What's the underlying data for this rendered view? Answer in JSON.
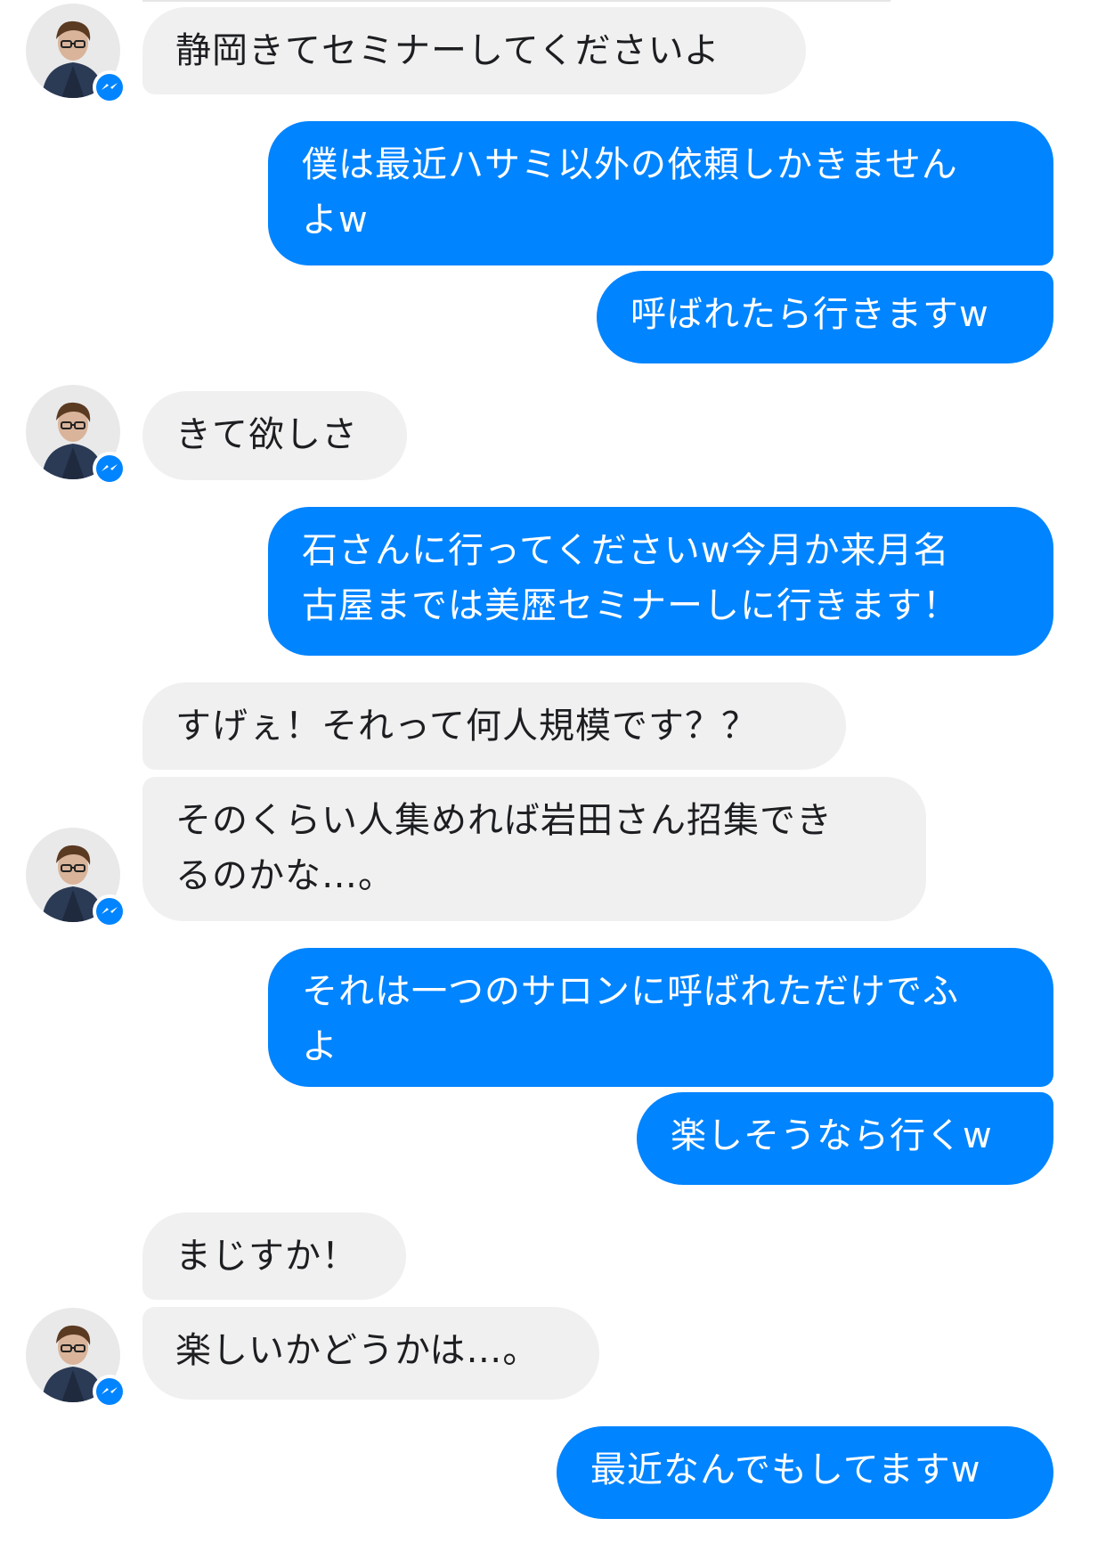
{
  "conversation": {
    "messages": [
      {
        "from": "them",
        "text": "静岡きてセミナーしてくださいよ"
      },
      {
        "from": "me",
        "text": "僕は最近ハサミ以外の依頼しかきません\nよw"
      },
      {
        "from": "me",
        "text": "呼ばれたら行きますw"
      },
      {
        "from": "them",
        "text": "きて欲しさ"
      },
      {
        "from": "me",
        "text": "石さんに行ってくださいw今月か来月名\n古屋までは美歴セミナーしに行きます！"
      },
      {
        "from": "them",
        "text": "すげぇ！それって何人規模です？？"
      },
      {
        "from": "them",
        "text": "そのくらい人集めれば岩田さん招集でき\nるのかな…。"
      },
      {
        "from": "me",
        "text": "それは一つのサロンに呼ばれただけでふ\nよ"
      },
      {
        "from": "me",
        "text": "楽しそうなら行くw"
      },
      {
        "from": "them",
        "text": "まじすか！"
      },
      {
        "from": "them",
        "text": "楽しいかどうかは…。"
      },
      {
        "from": "me",
        "text": "最近なんでもしてますw"
      }
    ]
  },
  "avatar": {
    "badge_icon": "messenger-icon",
    "badge_color": "#0084ff"
  },
  "colors": {
    "outgoing_bubble": "#0084ff",
    "incoming_bubble": "#f1f0f0",
    "incoming_text": "#1c1e21",
    "outgoing_text": "#ffffff"
  }
}
